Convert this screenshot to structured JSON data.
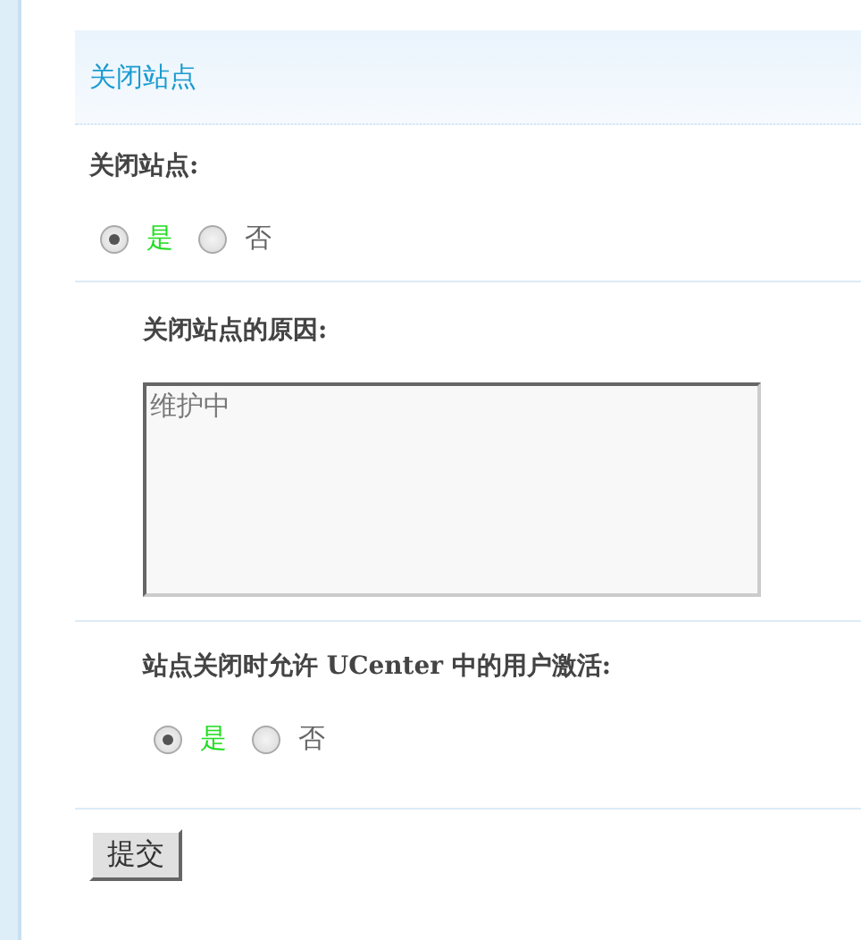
{
  "section": {
    "title": "关闭站点"
  },
  "settings": [
    {
      "kind": "radio",
      "label": "关闭站点:",
      "indent": false,
      "options": [
        {
          "label": "是",
          "selected": true
        },
        {
          "label": "否",
          "selected": false
        }
      ]
    },
    {
      "kind": "textarea",
      "label": "关闭站点的原因:",
      "indent": true,
      "value": "维护中"
    },
    {
      "kind": "radio",
      "label": "站点关闭时允许 UCenter 中的用户激活:",
      "indent": true,
      "options": [
        {
          "label": "是",
          "selected": true
        },
        {
          "label": "否",
          "selected": false
        }
      ]
    }
  ],
  "submit": {
    "label": "提交"
  }
}
